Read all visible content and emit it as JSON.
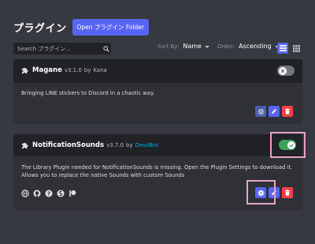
{
  "header": {
    "title": "プラグイン",
    "open_folder_label": "Open プラグイン Folder"
  },
  "search": {
    "placeholder": "Search プラグイン..."
  },
  "sort": {
    "sort_by_label": "Sort By:",
    "sort_by_value": "Name",
    "order_label": "Order:",
    "order_value": "Ascending",
    "view_mode": "list"
  },
  "plugins": [
    {
      "name": "Magane",
      "version": "v3.1.0",
      "by": "by",
      "author": "Kana",
      "description": "Bringing LINE stickers to Discord in a chaotic way.",
      "enabled": false
    },
    {
      "name": "NotificationSounds",
      "version": "v3.7.0",
      "by": "by",
      "author": "DevilBro",
      "description": "The Library Plugin needed for NotificationSounds is missing. Open the Plugin Settings to download it. Allows you to replace the native Sounds with custom Sounds",
      "enabled": true,
      "links": [
        "website-icon",
        "github-icon",
        "help-icon",
        "discord-icon",
        "patreon-icon"
      ]
    }
  ],
  "colors": {
    "background": "#36393f",
    "card": "#2f3136",
    "accent": "#5865f2",
    "danger": "#ed4245",
    "enabled": "#3ba55c",
    "highlight": "#e8a3c4"
  }
}
